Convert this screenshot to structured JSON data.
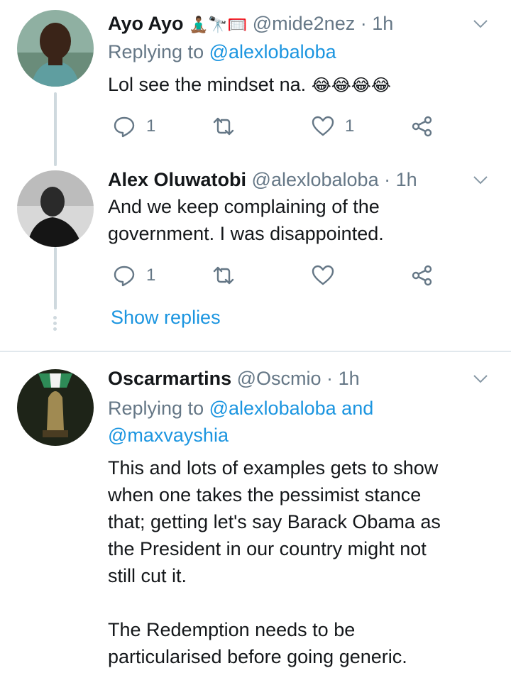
{
  "tweets": [
    {
      "name": "Ayo Ayo",
      "name_emojis": "🧘🏾‍♂️🔭🥅",
      "handle": "@mide2nez",
      "time": "1h",
      "replying_prefix": "Replying to",
      "replying_to": "@alexlobaloba",
      "text": "Lol see the mindset na.",
      "text_emojis": "😂😂😂😂",
      "reply_count": "1",
      "retweet_count": "",
      "like_count": "1"
    },
    {
      "name": "Alex Oluwatobi",
      "handle": "@alexlobaloba",
      "time": "1h",
      "text_line1": "And we keep complaining of the",
      "text_line2": "government. I was disappointed.",
      "reply_count": "1",
      "retweet_count": "",
      "like_count": "",
      "show_replies": "Show replies"
    },
    {
      "name": "Oscarmartins",
      "handle": "@Oscmio",
      "time": "1h",
      "replying_prefix": "Replying to",
      "replying_to_1": "@alexlobaloba",
      "replying_and": "and",
      "replying_to_2": "@maxvayshia",
      "text_lines": [
        "This and lots of examples gets to show",
        "when one takes the pessimist stance",
        "that; getting let's say Barack Obama as",
        "the President in our country might not",
        "still cut it.",
        "",
        "The Redemption needs to be",
        "particularised before going generic."
      ]
    }
  ],
  "separator": "·",
  "icons": {
    "reply": "reply-icon",
    "retweet": "retweet-icon",
    "like": "heart-icon",
    "share": "share-icon",
    "caret": "chevron-down-icon"
  },
  "colors": {
    "link": "#1b95e0",
    "muted": "#657786",
    "text": "#14171a",
    "thread_line": "#cfd9de"
  }
}
